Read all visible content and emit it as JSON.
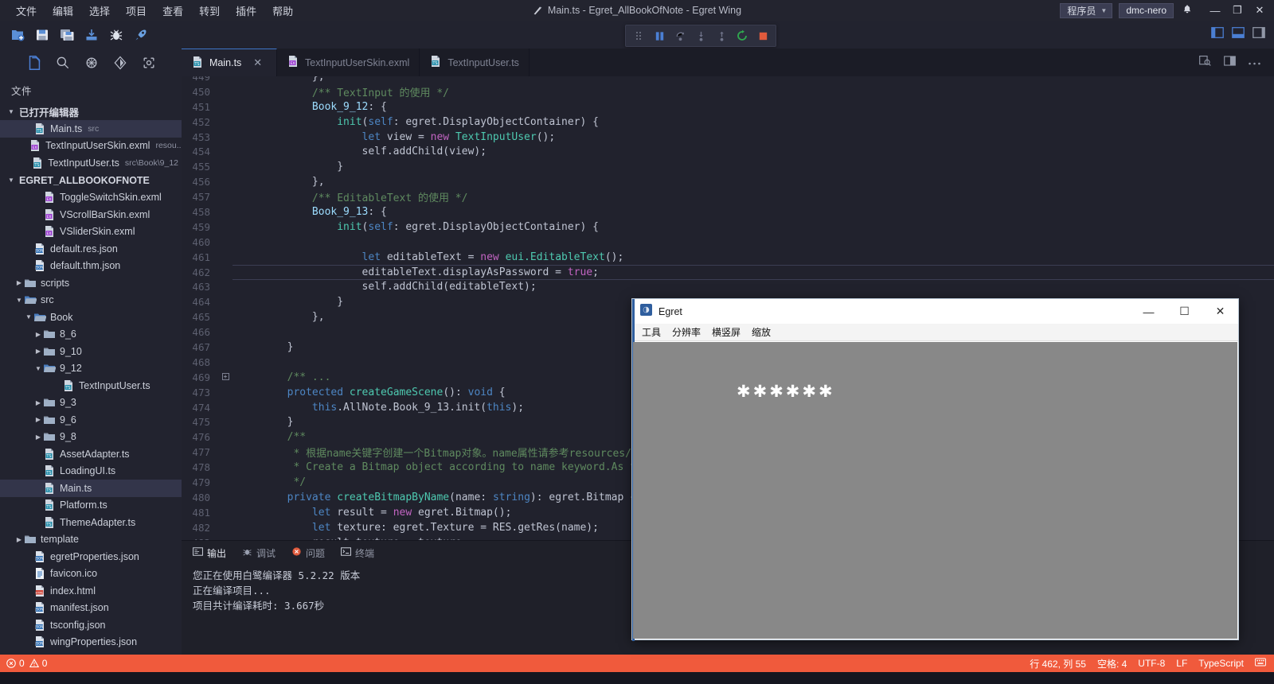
{
  "window": {
    "title": "Main.ts - Egret_AllBookOfNote - Egret Wing",
    "role_label": "程序员",
    "user_badge": "dmc-nero",
    "minimize": "—",
    "maximize": "❐",
    "close": "✕"
  },
  "menubar": [
    {
      "label": "文件"
    },
    {
      "label": "编辑"
    },
    {
      "label": "选择"
    },
    {
      "label": "项目"
    },
    {
      "label": "查看"
    },
    {
      "label": "转到"
    },
    {
      "label": "插件"
    },
    {
      "label": "帮助"
    }
  ],
  "toolbar_icons": [
    {
      "name": "new-file-icon"
    },
    {
      "name": "save-icon"
    },
    {
      "name": "save-all-icon"
    },
    {
      "name": "publish-icon"
    },
    {
      "name": "bug-icon"
    },
    {
      "name": "run-icon"
    }
  ],
  "debugbar": [
    {
      "name": "drag-handle-icon"
    },
    {
      "name": "pause-icon"
    },
    {
      "name": "step-over-icon"
    },
    {
      "name": "step-into-icon"
    },
    {
      "name": "step-out-icon"
    },
    {
      "name": "restart-icon"
    },
    {
      "name": "stop-icon"
    }
  ],
  "activitybar": [
    {
      "name": "explorer-icon",
      "active": true
    },
    {
      "name": "search-icon",
      "active": false
    },
    {
      "name": "extensions-icon",
      "active": false
    },
    {
      "name": "source-control-icon",
      "active": false
    },
    {
      "name": "debug-icon",
      "active": false
    }
  ],
  "sidebar": {
    "title": "文件",
    "sections": [
      {
        "label": "已打开编辑器",
        "expanded": true,
        "items": [
          {
            "label": "Main.ts",
            "meta": "src",
            "icon": "ts-file-icon",
            "indent": 2,
            "selected": true
          },
          {
            "label": "TextInputUserSkin.exml",
            "meta": "resou...",
            "icon": "exml-file-icon",
            "indent": 2,
            "selected": false
          },
          {
            "label": "TextInputUser.ts",
            "meta": "src\\Book\\9_12",
            "icon": "ts-file-icon",
            "indent": 2,
            "selected": false
          }
        ]
      },
      {
        "label": "EGRET_ALLBOOKOFNOTE",
        "expanded": true,
        "items": [
          {
            "label": "ToggleSwitchSkin.exml",
            "meta": "",
            "icon": "exml-file-icon",
            "indent": 3,
            "selected": false
          },
          {
            "label": "VScrollBarSkin.exml",
            "meta": "",
            "icon": "exml-file-icon",
            "indent": 3,
            "selected": false
          },
          {
            "label": "VSliderSkin.exml",
            "meta": "",
            "icon": "exml-file-icon",
            "indent": 3,
            "selected": false
          },
          {
            "label": "default.res.json",
            "meta": "",
            "icon": "json-file-icon",
            "indent": 2,
            "selected": false
          },
          {
            "label": "default.thm.json",
            "meta": "",
            "icon": "json-file-icon",
            "indent": 2,
            "selected": false
          },
          {
            "label": "scripts",
            "meta": "",
            "icon": "folder-icon",
            "indent": 1,
            "selected": false,
            "twisty": "collapsed"
          },
          {
            "label": "src",
            "meta": "",
            "icon": "folder-open-icon",
            "indent": 1,
            "selected": false,
            "twisty": "expanded"
          },
          {
            "label": "Book",
            "meta": "",
            "icon": "folder-open-icon",
            "indent": 2,
            "selected": false,
            "twisty": "expanded"
          },
          {
            "label": "8_6",
            "meta": "",
            "icon": "folder-icon",
            "indent": 3,
            "selected": false,
            "twisty": "collapsed"
          },
          {
            "label": "9_10",
            "meta": "",
            "icon": "folder-icon",
            "indent": 3,
            "selected": false,
            "twisty": "collapsed"
          },
          {
            "label": "9_12",
            "meta": "",
            "icon": "folder-open-icon",
            "indent": 3,
            "selected": false,
            "twisty": "expanded"
          },
          {
            "label": "TextInputUser.ts",
            "meta": "",
            "icon": "ts-file-icon",
            "indent": 5,
            "selected": false
          },
          {
            "label": "9_3",
            "meta": "",
            "icon": "folder-icon",
            "indent": 3,
            "selected": false,
            "twisty": "collapsed"
          },
          {
            "label": "9_6",
            "meta": "",
            "icon": "folder-icon",
            "indent": 3,
            "selected": false,
            "twisty": "collapsed"
          },
          {
            "label": "9_8",
            "meta": "",
            "icon": "folder-icon",
            "indent": 3,
            "selected": false,
            "twisty": "collapsed"
          },
          {
            "label": "AssetAdapter.ts",
            "meta": "",
            "icon": "ts-file-icon",
            "indent": 3,
            "selected": false
          },
          {
            "label": "LoadingUI.ts",
            "meta": "",
            "icon": "ts-file-icon",
            "indent": 3,
            "selected": false
          },
          {
            "label": "Main.ts",
            "meta": "",
            "icon": "ts-file-icon",
            "indent": 3,
            "selected": true
          },
          {
            "label": "Platform.ts",
            "meta": "",
            "icon": "ts-file-icon",
            "indent": 3,
            "selected": false
          },
          {
            "label": "ThemeAdapter.ts",
            "meta": "",
            "icon": "ts-file-icon",
            "indent": 3,
            "selected": false
          },
          {
            "label": "template",
            "meta": "",
            "icon": "folder-icon",
            "indent": 1,
            "selected": false,
            "twisty": "collapsed"
          },
          {
            "label": "egretProperties.json",
            "meta": "",
            "icon": "json-file-icon",
            "indent": 2,
            "selected": false
          },
          {
            "label": "favicon.ico",
            "meta": "",
            "icon": "ico-file-icon",
            "indent": 2,
            "selected": false
          },
          {
            "label": "index.html",
            "meta": "",
            "icon": "html-file-icon",
            "indent": 2,
            "selected": false
          },
          {
            "label": "manifest.json",
            "meta": "",
            "icon": "json-file-icon",
            "indent": 2,
            "selected": false
          },
          {
            "label": "tsconfig.json",
            "meta": "",
            "icon": "json-file-icon",
            "indent": 2,
            "selected": false
          },
          {
            "label": "wingProperties.json",
            "meta": "",
            "icon": "json-file-icon",
            "indent": 2,
            "selected": false
          }
        ]
      }
    ]
  },
  "tabs": [
    {
      "label": "Main.ts",
      "icon": "ts-file-icon",
      "active": true,
      "closable": true,
      "close_glyph": "✕"
    },
    {
      "label": "TextInputUserSkin.exml",
      "icon": "exml-file-icon",
      "active": false,
      "closable": false
    },
    {
      "label": "TextInputUser.ts",
      "icon": "ts-file-icon",
      "active": false,
      "closable": false
    }
  ],
  "tabbar_right_icons": [
    {
      "name": "open-preview-icon"
    },
    {
      "name": "split-editor-icon"
    },
    {
      "name": "more-actions-icon"
    }
  ],
  "layout_toggle_icons": [
    {
      "name": "toggle-sidebar-icon"
    },
    {
      "name": "toggle-panel-icon"
    },
    {
      "name": "toggle-right-sidebar-icon"
    }
  ],
  "editor": {
    "first_partial_line": "449",
    "lines": [
      {
        "num": "449",
        "tokens": [
          {
            "t": "            },",
            "c": "c-punc"
          }
        ]
      },
      {
        "num": "450",
        "tokens": [
          {
            "t": "            ",
            "c": "c-punc"
          },
          {
            "t": "/** TextInput 的使用 */",
            "c": "c-cmt"
          }
        ]
      },
      {
        "num": "451",
        "tokens": [
          {
            "t": "            ",
            "c": "c-punc"
          },
          {
            "t": "Book_9_12",
            "c": "c-prop"
          },
          {
            "t": ": {",
            "c": "c-punc"
          }
        ]
      },
      {
        "num": "452",
        "tokens": [
          {
            "t": "                ",
            "c": "c-punc"
          },
          {
            "t": "init",
            "c": "c-fn"
          },
          {
            "t": "(",
            "c": "c-punc"
          },
          {
            "t": "self",
            "c": "c-key"
          },
          {
            "t": ": egret.DisplayObjectContainer) {",
            "c": "c-punc"
          }
        ]
      },
      {
        "num": "453",
        "tokens": [
          {
            "t": "                    ",
            "c": "c-punc"
          },
          {
            "t": "let",
            "c": "c-key"
          },
          {
            "t": " view = ",
            "c": "c-punc"
          },
          {
            "t": "new",
            "c": "c-key2"
          },
          {
            "t": " ",
            "c": "c-punc"
          },
          {
            "t": "TextInputUser",
            "c": "c-type"
          },
          {
            "t": "();",
            "c": "c-punc"
          }
        ]
      },
      {
        "num": "454",
        "tokens": [
          {
            "t": "                    self.",
            "c": "c-punc"
          },
          {
            "t": "addChild",
            "c": "c-punc"
          },
          {
            "t": "(view);",
            "c": "c-punc"
          }
        ]
      },
      {
        "num": "455",
        "tokens": [
          {
            "t": "                }",
            "c": "c-punc"
          }
        ]
      },
      {
        "num": "456",
        "tokens": [
          {
            "t": "            },",
            "c": "c-punc"
          }
        ]
      },
      {
        "num": "457",
        "tokens": [
          {
            "t": "            ",
            "c": "c-punc"
          },
          {
            "t": "/** EditableText 的使用 */",
            "c": "c-cmt"
          }
        ]
      },
      {
        "num": "458",
        "tokens": [
          {
            "t": "            ",
            "c": "c-punc"
          },
          {
            "t": "Book_9_13",
            "c": "c-prop"
          },
          {
            "t": ": {",
            "c": "c-punc"
          }
        ]
      },
      {
        "num": "459",
        "tokens": [
          {
            "t": "                ",
            "c": "c-punc"
          },
          {
            "t": "init",
            "c": "c-fn"
          },
          {
            "t": "(",
            "c": "c-punc"
          },
          {
            "t": "self",
            "c": "c-key"
          },
          {
            "t": ": egret.DisplayObjectContainer) {",
            "c": "c-punc"
          }
        ]
      },
      {
        "num": "460",
        "tokens": [
          {
            "t": "",
            "c": "c-punc"
          }
        ]
      },
      {
        "num": "461",
        "tokens": [
          {
            "t": "                    ",
            "c": "c-punc"
          },
          {
            "t": "let",
            "c": "c-key"
          },
          {
            "t": " editableText = ",
            "c": "c-punc"
          },
          {
            "t": "new",
            "c": "c-key2"
          },
          {
            "t": " ",
            "c": "c-punc"
          },
          {
            "t": "eui.EditableText",
            "c": "c-type"
          },
          {
            "t": "();",
            "c": "c-punc"
          }
        ]
      },
      {
        "num": "462",
        "current": true,
        "tokens": [
          {
            "t": "                    editableText.displayAsPassword = ",
            "c": "c-punc"
          },
          {
            "t": "true",
            "c": "c-key2"
          },
          {
            "t": ";",
            "c": "c-punc"
          }
        ]
      },
      {
        "num": "463",
        "tokens": [
          {
            "t": "                    self.addChild(editableText);",
            "c": "c-punc"
          }
        ]
      },
      {
        "num": "464",
        "tokens": [
          {
            "t": "                }",
            "c": "c-punc"
          }
        ]
      },
      {
        "num": "465",
        "tokens": [
          {
            "t": "            },",
            "c": "c-punc"
          }
        ]
      },
      {
        "num": "466",
        "tokens": [
          {
            "t": "",
            "c": "c-punc"
          }
        ]
      },
      {
        "num": "467",
        "tokens": [
          {
            "t": "        }",
            "c": "c-punc"
          }
        ]
      },
      {
        "num": "468",
        "tokens": [
          {
            "t": "",
            "c": "c-punc"
          }
        ]
      },
      {
        "num": "469",
        "folded": true,
        "tokens": [
          {
            "t": "        /** ...",
            "c": "c-cmt"
          }
        ]
      },
      {
        "num": "473",
        "tokens": [
          {
            "t": "        ",
            "c": "c-punc"
          },
          {
            "t": "protected",
            "c": "c-key"
          },
          {
            "t": " ",
            "c": "c-punc"
          },
          {
            "t": "createGameScene",
            "c": "c-fn"
          },
          {
            "t": "(): ",
            "c": "c-punc"
          },
          {
            "t": "void",
            "c": "c-key"
          },
          {
            "t": " {",
            "c": "c-punc"
          }
        ]
      },
      {
        "num": "474",
        "tokens": [
          {
            "t": "            ",
            "c": "c-punc"
          },
          {
            "t": "this",
            "c": "c-key"
          },
          {
            "t": ".AllNote.Book_9_13.init(",
            "c": "c-punc"
          },
          {
            "t": "this",
            "c": "c-key"
          },
          {
            "t": ");",
            "c": "c-punc"
          }
        ]
      },
      {
        "num": "475",
        "tokens": [
          {
            "t": "        }",
            "c": "c-punc"
          }
        ]
      },
      {
        "num": "476",
        "tokens": [
          {
            "t": "        ",
            "c": "c-punc"
          },
          {
            "t": "/**",
            "c": "c-cmt"
          }
        ]
      },
      {
        "num": "477",
        "tokens": [
          {
            "t": "         ",
            "c": "c-punc"
          },
          {
            "t": "* 根据name关键字创建一个Bitmap对象。name属性请参考resources/resou",
            "c": "c-cmt"
          }
        ]
      },
      {
        "num": "478",
        "tokens": [
          {
            "t": "         ",
            "c": "c-punc"
          },
          {
            "t": "* Create a Bitmap object according to name keyword.As for the",
            "c": "c-cmt"
          }
        ]
      },
      {
        "num": "479",
        "tokens": [
          {
            "t": "         ",
            "c": "c-punc"
          },
          {
            "t": "*/",
            "c": "c-cmt"
          }
        ]
      },
      {
        "num": "480",
        "tokens": [
          {
            "t": "        ",
            "c": "c-punc"
          },
          {
            "t": "private",
            "c": "c-key"
          },
          {
            "t": " ",
            "c": "c-punc"
          },
          {
            "t": "createBitmapByName",
            "c": "c-fn"
          },
          {
            "t": "(name: ",
            "c": "c-punc"
          },
          {
            "t": "string",
            "c": "c-key"
          },
          {
            "t": "): egret.Bitmap {",
            "c": "c-punc"
          }
        ]
      },
      {
        "num": "481",
        "tokens": [
          {
            "t": "            ",
            "c": "c-punc"
          },
          {
            "t": "let",
            "c": "c-key"
          },
          {
            "t": " result = ",
            "c": "c-punc"
          },
          {
            "t": "new",
            "c": "c-key2"
          },
          {
            "t": " egret.Bitmap();",
            "c": "c-punc"
          }
        ]
      },
      {
        "num": "482",
        "tokens": [
          {
            "t": "            ",
            "c": "c-punc"
          },
          {
            "t": "let",
            "c": "c-key"
          },
          {
            "t": " texture: egret.Texture = RES.getRes(name);",
            "c": "c-punc"
          }
        ]
      },
      {
        "num": "483",
        "tokens": [
          {
            "t": "            result.texture = texture;",
            "c": "c-punc"
          }
        ]
      }
    ]
  },
  "panel": {
    "tabs": [
      {
        "label": "输出",
        "icon": "output-icon",
        "active": true
      },
      {
        "label": "调试",
        "icon": "debug-console-icon",
        "active": false
      },
      {
        "label": "问题",
        "icon": "problems-icon",
        "active": false
      },
      {
        "label": "终端",
        "icon": "terminal-icon",
        "active": false
      }
    ],
    "output_lines": [
      "您正在使用白鹭编译器  5.2.22  版本",
      "正在编译项目...",
      "项目共计编译耗时: 3.667秒"
    ]
  },
  "statusbar": {
    "errors": "0",
    "warnings": "0",
    "cursor": "行 462, 列 55",
    "indent": "空格: 4",
    "encoding": "UTF-8",
    "eol": "LF",
    "language": "TypeScript",
    "bg": "#f05a3c"
  },
  "egret_window": {
    "title": "Egret",
    "menu": [
      {
        "label": "工具"
      },
      {
        "label": "分辨率"
      },
      {
        "label": "横竖屏"
      },
      {
        "label": "缩放"
      }
    ],
    "content": "✱✱✱✱✱✱",
    "minimize": "—",
    "maximize": "☐",
    "close": "✕",
    "canvas_bg": "#888888"
  }
}
